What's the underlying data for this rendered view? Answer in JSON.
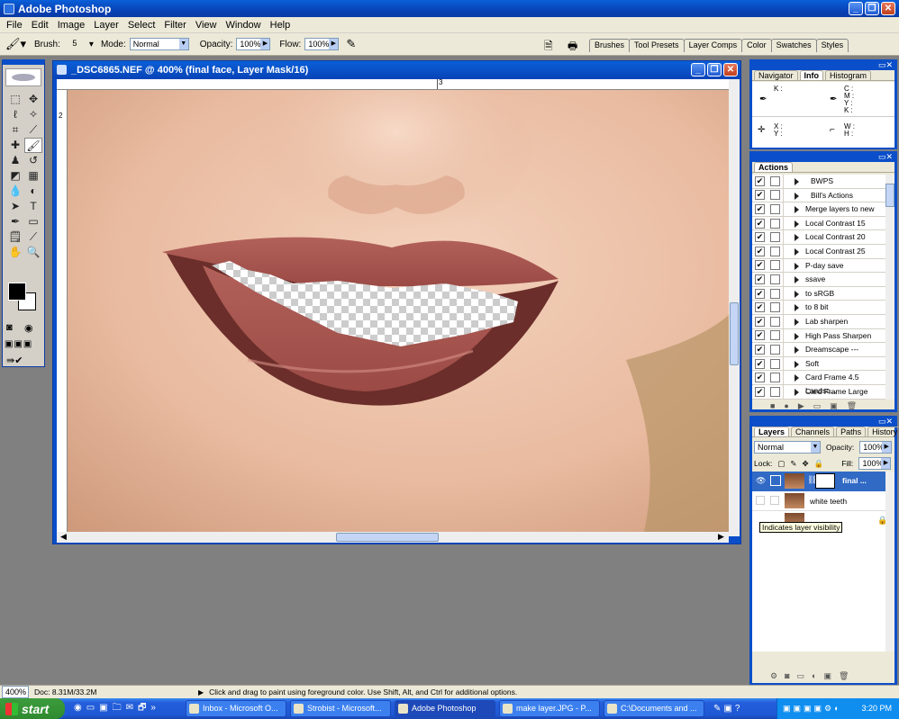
{
  "app": {
    "title": "Adobe Photoshop"
  },
  "menu": [
    "File",
    "Edit",
    "Image",
    "Layer",
    "Select",
    "Filter",
    "View",
    "Window",
    "Help"
  ],
  "options": {
    "brush_label": "Brush:",
    "brush_size": "5",
    "mode_label": "Mode:",
    "mode_value": "Normal",
    "opacity_label": "Opacity:",
    "opacity_value": "100%",
    "flow_label": "Flow:",
    "flow_value": "100%"
  },
  "palette_well": [
    "Brushes",
    "Tool Presets",
    "Layer Comps",
    "Color",
    "Swatches",
    "Styles"
  ],
  "document": {
    "title": "_DSC6865.NEF @ 400% (final face, Layer Mask/16)",
    "ruler_h_mark": "3",
    "ruler_v_mark": "2"
  },
  "navigator_panel": {
    "tabs": [
      "Navigator",
      "Info",
      "Histogram"
    ],
    "active_tab": "Info",
    "k_label": "K :",
    "c_label": "C :",
    "m_label": "M :",
    "y_label": "Y :",
    "k2_label": "K :",
    "x_label": "X :",
    "y2_label": "Y :",
    "w_label": "W :",
    "h_label": "H :"
  },
  "actions_panel": {
    "tab": "Actions",
    "items": [
      {
        "name": "BWPS",
        "type": "set",
        "checked": "✔"
      },
      {
        "name": "Bill's Actions",
        "type": "set",
        "checked": "✔"
      },
      {
        "name": "Merge layers to new",
        "checked": "✔"
      },
      {
        "name": "Local Contrast 15",
        "checked": "✔"
      },
      {
        "name": "Local Contrast 20",
        "checked": "✔"
      },
      {
        "name": "Local Contrast 25",
        "checked": "✔"
      },
      {
        "name": "P-day save",
        "checked": "✔"
      },
      {
        "name": "ssave",
        "checked": "✔"
      },
      {
        "name": "to sRGB",
        "checked": "✔"
      },
      {
        "name": "to 8 bit",
        "checked": "✔"
      },
      {
        "name": "Lab sharpen",
        "checked": "✔"
      },
      {
        "name": "High Pass Sharpen",
        "checked": "✔"
      },
      {
        "name": "Dreamscape ---",
        "checked": "✔"
      },
      {
        "name": "Soft",
        "checked": "✔"
      },
      {
        "name": "Card Frame 4.5 Landsc...",
        "checked": "✔"
      },
      {
        "name": "Card Frame Large",
        "checked": "✔"
      }
    ]
  },
  "layers_panel": {
    "tabs": [
      "Layers",
      "Channels",
      "Paths",
      "History"
    ],
    "active_tab": "Layers",
    "blend_mode": "Normal",
    "opacity_label": "Opacity:",
    "opacity_value": "100%",
    "lock_label": "Lock:",
    "fill_label": "Fill:",
    "fill_value": "100%",
    "layers": [
      {
        "name": "final ...",
        "selected": true
      },
      {
        "name": "white teeth"
      }
    ],
    "tooltip": "Indicates layer visibility"
  },
  "status": {
    "zoom": "400%",
    "doc": "Doc: 8.31M/33.2M",
    "hint": "Click and drag to paint using foreground color.  Use Shift, Alt, and Ctrl for additional options."
  },
  "taskbar": {
    "start_label": "start",
    "buttons": [
      {
        "label": "Inbox - Microsoft O..."
      },
      {
        "label": "Strobist - Microsoft..."
      },
      {
        "label": "Adobe Photoshop",
        "active": true
      },
      {
        "label": "make layer.JPG - P..."
      },
      {
        "label": "C:\\Documents and ..."
      }
    ],
    "time": "3:20 PM"
  },
  "colors": {
    "xp_blue": "#0a4ec9",
    "panel_bg": "#ece9d8",
    "workspace": "#808080"
  }
}
